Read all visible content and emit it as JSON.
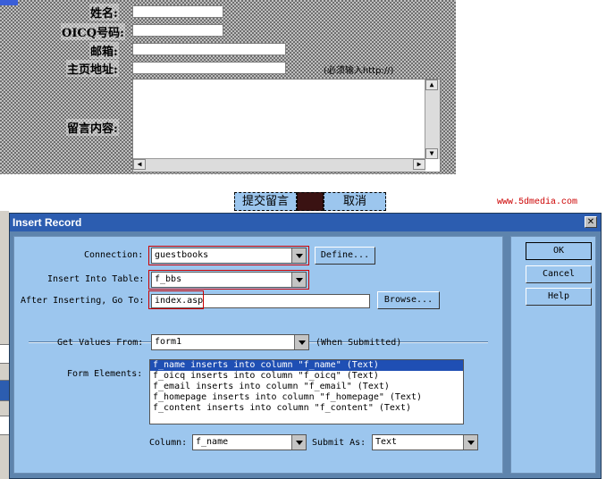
{
  "guestbook": {
    "labels": {
      "name": "姓名:",
      "oicq": "OICQ号码:",
      "email": "邮箱:",
      "homepage": "主页地址:",
      "content": "留言内容:"
    },
    "homepage_hint": "(必须输入http://)",
    "submit_label": "提交留言",
    "cancel_label": "取消",
    "site": "www.5dmedia.com"
  },
  "dialog": {
    "title": "Insert Record",
    "connection_label": "Connection:",
    "connection_value": "guestbooks",
    "define_label": "Define...",
    "table_label": "Insert Into Table:",
    "table_value": "f_bbs",
    "after_label": "After Inserting, Go To:",
    "after_value": "index.asp",
    "browse_label": "Browse...",
    "get_values_label": "Get Values From:",
    "get_values_value": "form1",
    "when_submitted": "(When Submitted)",
    "form_elements_label": "Form Elements:",
    "form_elements": [
      "f_name inserts into column \"f_name\" (Text)",
      "f_oicq inserts into column \"f_oicq\" (Text)",
      "f_email inserts into column \"f_email\" (Text)",
      "f_homepage inserts into column \"f_homepage\" (Text)",
      "f_content inserts into column \"f_content\" (Text)"
    ],
    "column_label": "Column:",
    "column_value": "f_name",
    "submit_as_label": "Submit As:",
    "submit_as_value": "Text",
    "ok_label": "OK",
    "cancel_label": "Cancel",
    "help_label": "Help"
  },
  "colors": {
    "dialog_bg": "#5e84ad",
    "panel_bg": "#9cc6ee",
    "titlebar": "#2c5db0",
    "highlight_box": "#cc0000",
    "selection": "#1f4fb4"
  }
}
